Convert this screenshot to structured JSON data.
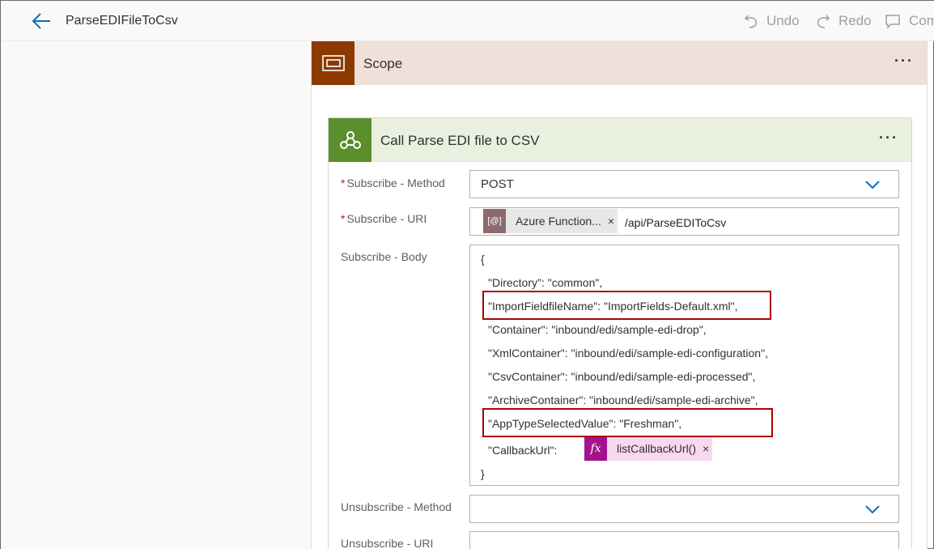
{
  "header": {
    "flow_title": "ParseEDIFileToCsv",
    "undo_label": "Undo",
    "redo_label": "Redo",
    "comment_label": "Com"
  },
  "scope": {
    "title": "Scope",
    "more_label": "···"
  },
  "action": {
    "title": "Call Parse EDI file to CSV",
    "more_label": "···",
    "fields": {
      "subscribe_method": {
        "required_mark": "*",
        "label": "Subscribe - Method",
        "value": "POST"
      },
      "subscribe_uri": {
        "required_mark": "*",
        "label": "Subscribe - URI",
        "token_icon_text": "[@]",
        "token_label": "Azure Function...",
        "token_close": "×",
        "suffix": "/api/ParseEDIToCsv"
      },
      "subscribe_body": {
        "label": "Subscribe - Body",
        "lines": [
          "{",
          "\"Directory\": \"common\",",
          "\"ImportFieldfileName\": \"ImportFields-Default.xml\",",
          "\"Container\": \"inbound/edi/sample-edi-drop\",",
          "\"XmlContainer\": \"inbound/edi/sample-edi-configuration\",",
          "\"CsvContainer\": \"inbound/edi/sample-edi-processed\",",
          "\"ArchiveContainer\": \"inbound/edi/sample-edi-archive\",",
          "\"AppTypeSelectedValue\": \"Freshman\","
        ],
        "callback_key": "\"CallbackUrl\":",
        "callback_token_icon": "fx",
        "callback_token_label": "listCallbackUrl()",
        "callback_token_close": "×",
        "closing_brace": "}"
      },
      "unsubscribe_method": {
        "label": "Unsubscribe - Method",
        "value": ""
      },
      "unsubscribe_uri": {
        "label": "Unsubscribe - URI",
        "value": ""
      }
    }
  },
  "colors": {
    "scope_accent": "#8c3a00",
    "scope_header_bg": "#efe0d9",
    "http_accent": "#5b8e2c",
    "http_header_bg": "#e9f0df",
    "token_azure_function": "#8c6b70",
    "token_expression": "#a4138e",
    "highlight": "#b00000"
  }
}
